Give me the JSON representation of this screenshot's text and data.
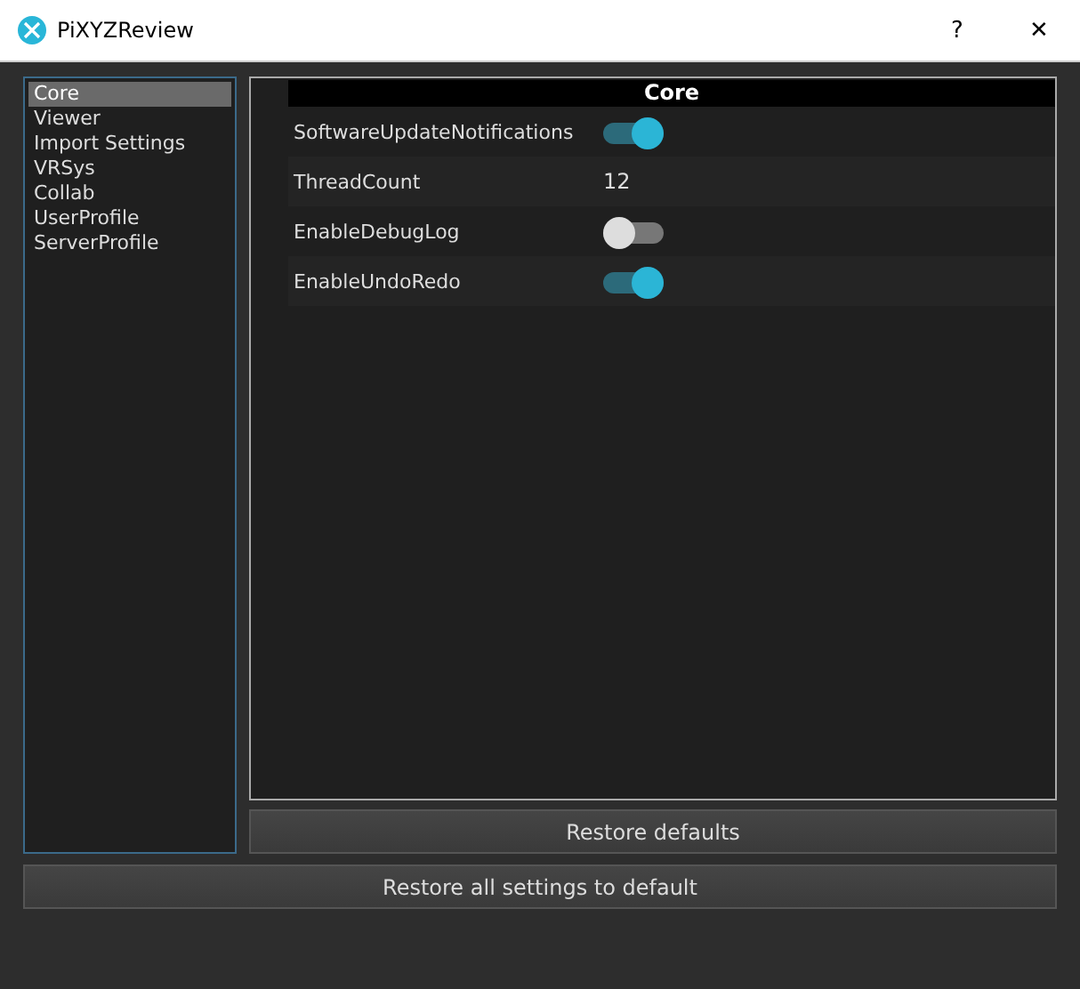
{
  "window": {
    "title": "PiXYZReview",
    "buttons": [
      "?",
      "✕"
    ]
  },
  "sidebar": {
    "items": [
      {
        "label": "Core",
        "selected": true
      },
      {
        "label": "Viewer",
        "selected": false
      },
      {
        "label": "Import Settings",
        "selected": false
      },
      {
        "label": "VRSys",
        "selected": false
      },
      {
        "label": "Collab",
        "selected": false
      },
      {
        "label": "UserProfile",
        "selected": false
      },
      {
        "label": "ServerProfile",
        "selected": false
      }
    ]
  },
  "panel": {
    "header": "Core",
    "settings": [
      {
        "name": "SoftwareUpdateNotifications",
        "kind": "toggle",
        "on": true
      },
      {
        "name": "ThreadCount",
        "kind": "value",
        "value": "12"
      },
      {
        "name": "EnableDebugLog",
        "kind": "toggle",
        "on": false
      },
      {
        "name": "EnableUndoRedo",
        "kind": "toggle",
        "on": true
      }
    ]
  },
  "restore_button": "Restore defaults",
  "restore_all_button": "Restore all settings to default"
}
